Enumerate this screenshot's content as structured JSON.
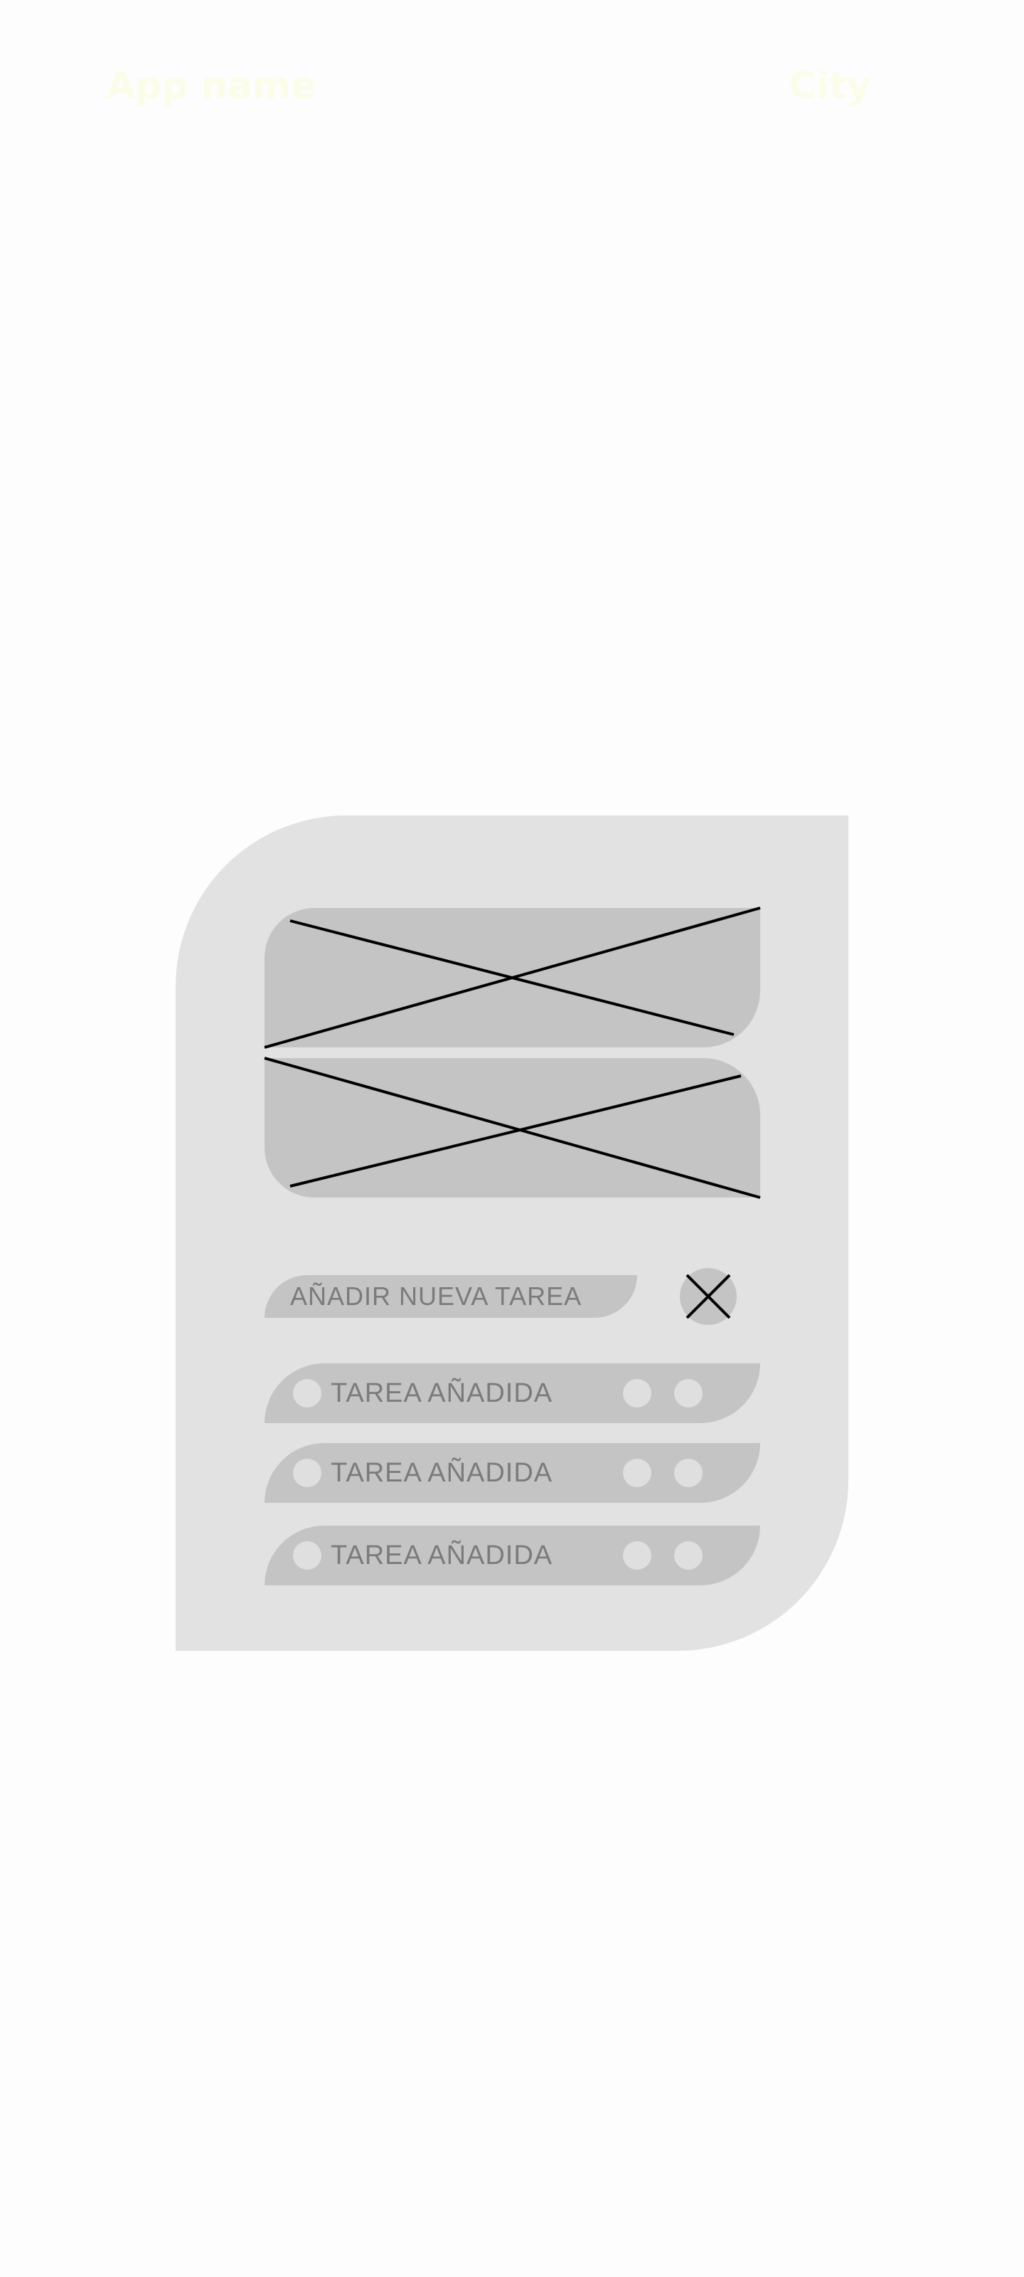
{
  "header": {
    "app_name": "App name",
    "city": "City"
  },
  "colors": {
    "header_text": "#fbfde8",
    "card_background": "#e3e2e3",
    "element_fill": "#c4c4c4",
    "text_muted": "#7b7b7b"
  },
  "new_task": {
    "placeholder": "AÑADIR NUEVA TAREA",
    "close_icon": "close-icon"
  },
  "tasks": [
    {
      "label": "TAREA AÑADIDA"
    },
    {
      "label": "TAREA AÑADIDA"
    },
    {
      "label": "TAREA AÑADIDA"
    }
  ]
}
